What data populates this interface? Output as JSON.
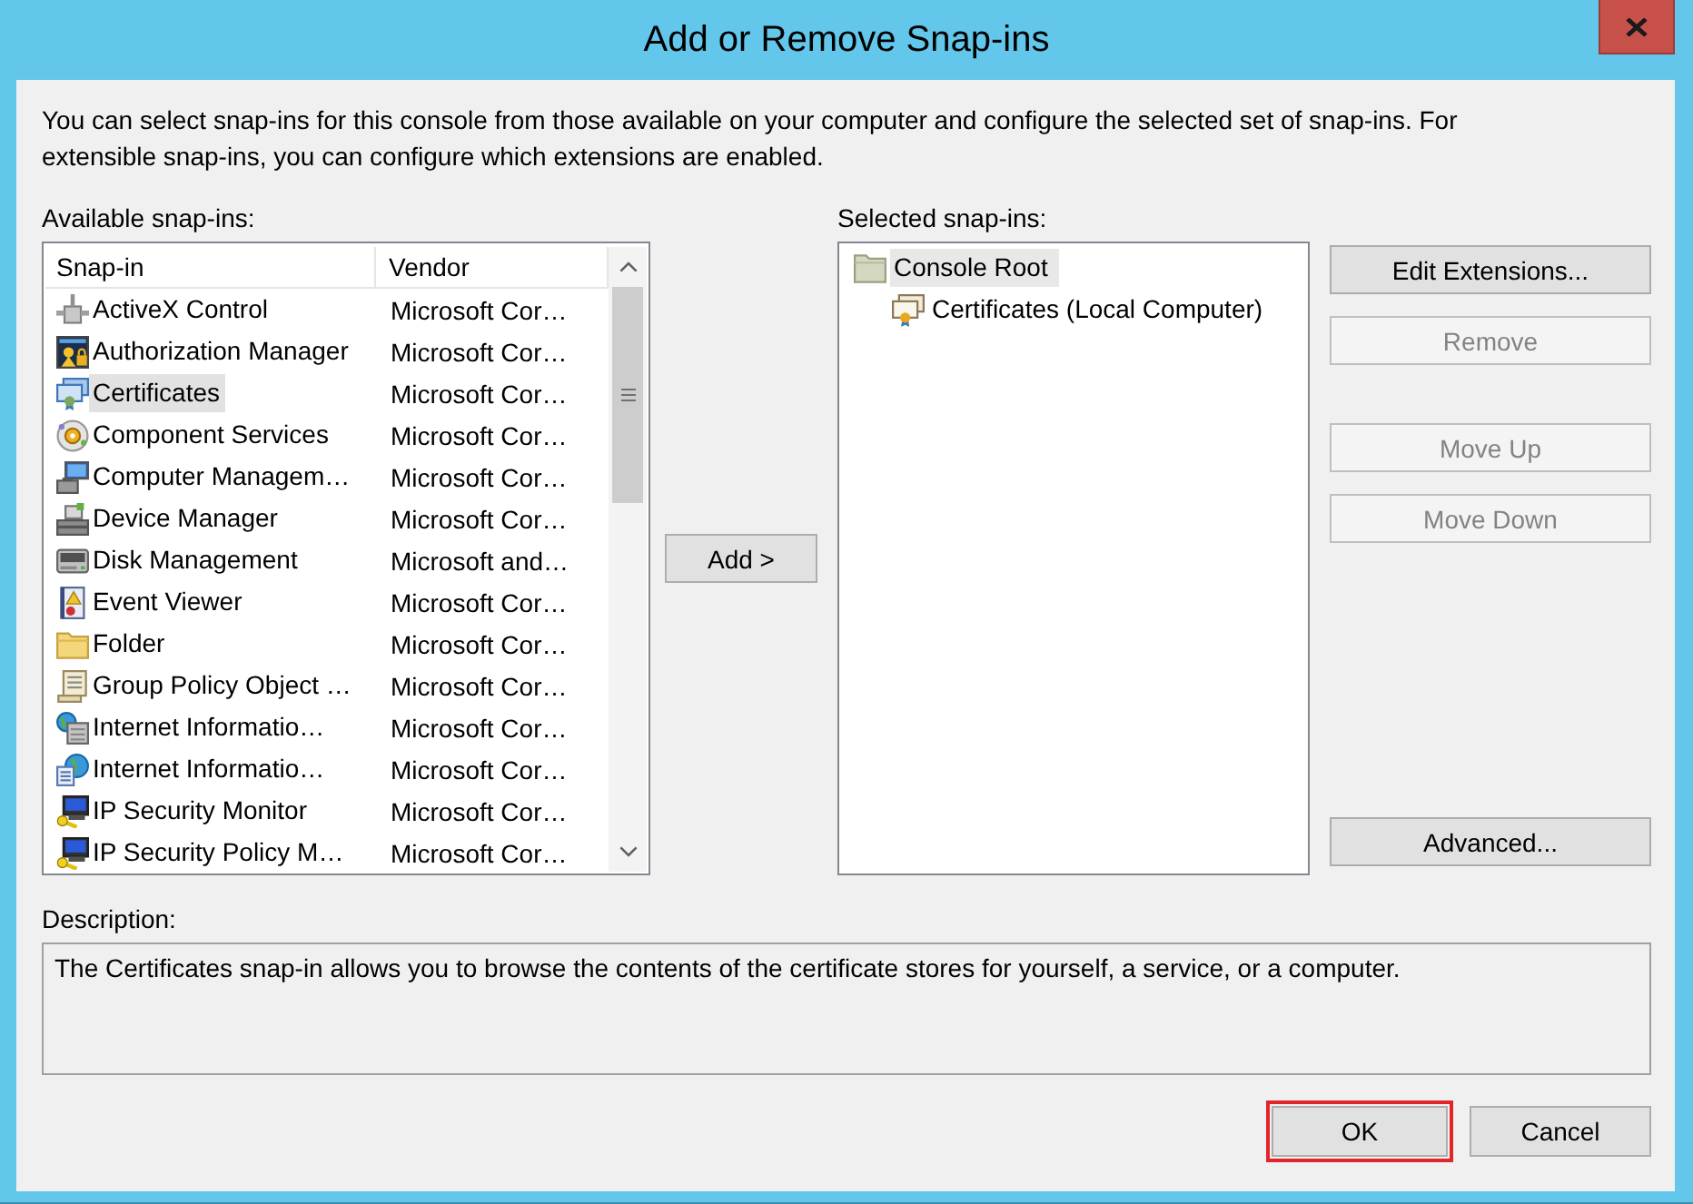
{
  "window": {
    "title": "Add or Remove Snap-ins"
  },
  "intro": "You can select snap-ins for this console from those available on your computer and configure the selected set of snap-ins. For extensible snap-ins, you can configure which extensions are enabled.",
  "available": {
    "label": "Available snap-ins:",
    "columns": [
      "Snap-in",
      "Vendor"
    ],
    "rows": [
      {
        "name": "ActiveX Control",
        "vendor": "Microsoft Cor…",
        "selected": false
      },
      {
        "name": "Authorization Manager",
        "vendor": "Microsoft Cor…",
        "selected": false
      },
      {
        "name": "Certificates",
        "vendor": "Microsoft Cor…",
        "selected": true
      },
      {
        "name": "Component Services",
        "vendor": "Microsoft Cor…",
        "selected": false
      },
      {
        "name": "Computer Managem…",
        "vendor": "Microsoft Cor…",
        "selected": false
      },
      {
        "name": "Device Manager",
        "vendor": "Microsoft Cor…",
        "selected": false
      },
      {
        "name": "Disk Management",
        "vendor": "Microsoft and…",
        "selected": false
      },
      {
        "name": "Event Viewer",
        "vendor": "Microsoft Cor…",
        "selected": false
      },
      {
        "name": "Folder",
        "vendor": "Microsoft Cor…",
        "selected": false
      },
      {
        "name": "Group Policy Object …",
        "vendor": "Microsoft Cor…",
        "selected": false
      },
      {
        "name": "Internet Informatio…",
        "vendor": "Microsoft Cor…",
        "selected": false
      },
      {
        "name": "Internet Informatio…",
        "vendor": "Microsoft Cor…",
        "selected": false
      },
      {
        "name": "IP Security Monitor",
        "vendor": "Microsoft Cor…",
        "selected": false
      },
      {
        "name": "IP Security Policy M…",
        "vendor": "Microsoft Cor…",
        "selected": false
      }
    ]
  },
  "add_button": {
    "label": "Add >"
  },
  "selected_snapins": {
    "label": "Selected snap-ins:",
    "tree": [
      {
        "label": "Console Root",
        "selected": true,
        "children": [
          {
            "label": "Certificates (Local Computer)",
            "selected": false
          }
        ]
      }
    ]
  },
  "side_button_groups": [
    {
      "buttons": [
        {
          "label": "Edit Extensions...",
          "disabled": false
        },
        {
          "label": "Remove",
          "disabled": true
        }
      ]
    },
    {
      "buttons": [
        {
          "label": "Move Up",
          "disabled": true
        },
        {
          "label": "Move Down",
          "disabled": true
        }
      ]
    },
    {
      "buttons": [
        {
          "label": "Advanced...",
          "disabled": false
        }
      ]
    }
  ],
  "description": {
    "label": "Description:",
    "text": "The Certificates snap-in allows you to browse the contents of the certificate stores for yourself, a service, or a computer."
  },
  "footer_buttons": [
    {
      "label": "OK",
      "highlighted": true
    },
    {
      "label": "Cancel",
      "highlighted": false
    }
  ]
}
